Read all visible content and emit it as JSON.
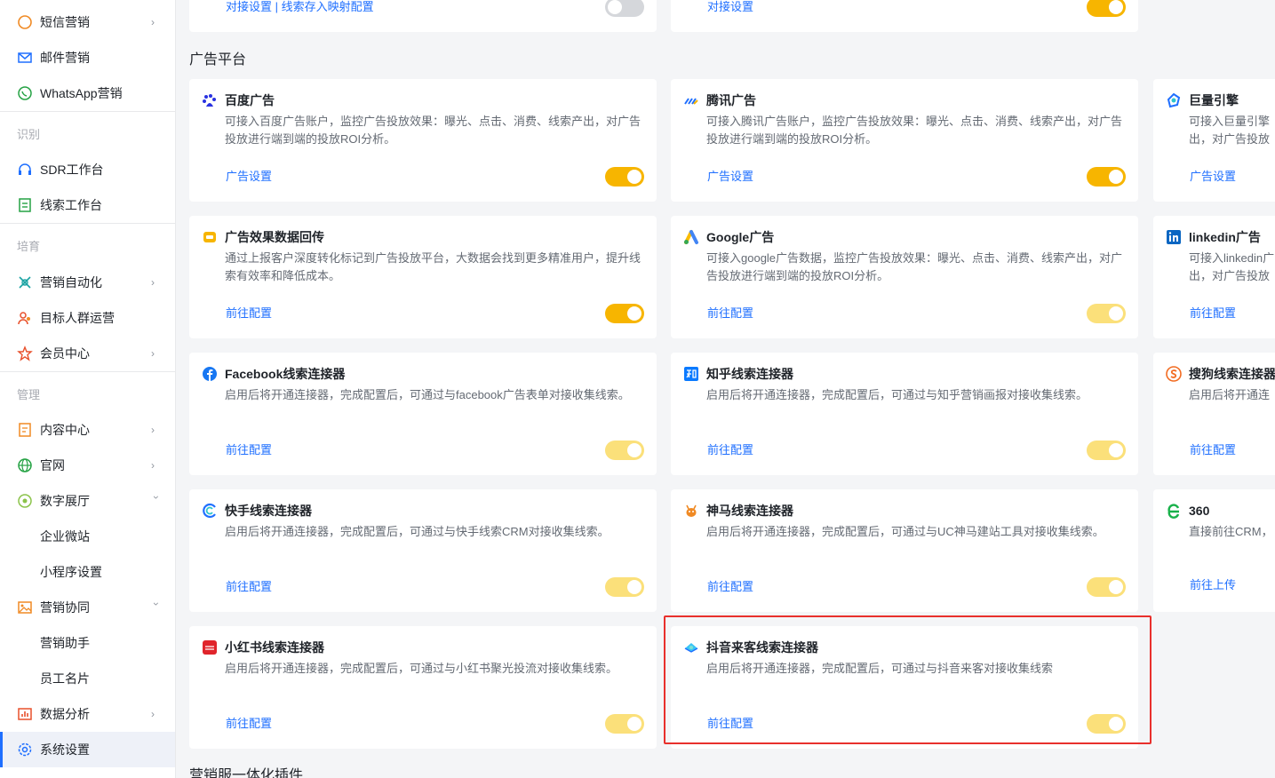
{
  "sidebar": {
    "items": [
      {
        "label": "短信营销",
        "icon": "sms-icon"
      },
      {
        "label": "邮件营销",
        "icon": "mail-icon"
      },
      {
        "label": "WhatsApp营销",
        "icon": "whatsapp-icon"
      },
      {
        "label": "SDR工作台",
        "icon": "headset-icon"
      },
      {
        "label": "线索工作台",
        "icon": "board-icon"
      },
      {
        "label": "营销自动化",
        "icon": "automation-icon"
      },
      {
        "label": "目标人群运营",
        "icon": "people-icon"
      },
      {
        "label": "会员中心",
        "icon": "star-icon"
      },
      {
        "label": "内容中心",
        "icon": "document-icon"
      },
      {
        "label": "官网",
        "icon": "globe-icon"
      },
      {
        "label": "数字展厅",
        "icon": "gallery-icon"
      },
      {
        "label": "企业微站"
      },
      {
        "label": "小程序设置"
      },
      {
        "label": "营销协同",
        "icon": "image-icon"
      },
      {
        "label": "营销助手"
      },
      {
        "label": "员工名片"
      },
      {
        "label": "数据分析",
        "icon": "chart-icon"
      },
      {
        "label": "系统设置",
        "icon": "gear-icon"
      }
    ],
    "sections": {
      "identify": "识别",
      "cultivate": "培育",
      "manage": "管理"
    }
  },
  "top_cards": {
    "left_link": "对接设置 | 线索存入映射配置",
    "right_link": "对接设置"
  },
  "ad_section": {
    "title": "广告平台",
    "cards": [
      {
        "title": "百度广告",
        "desc": "可接入百度广告账户，监控广告投放效果：曝光、点击、消费、线索产出，对广告投放进行端到端的投放ROI分析。",
        "link": "广告设置"
      },
      {
        "title": "腾讯广告",
        "desc": "可接入腾讯广告账户，监控广告投放效果：曝光、点击、消费、线索产出，对广告投放进行端到端的投放ROI分析。",
        "link": "广告设置"
      },
      {
        "title": "巨量引擎",
        "desc": "可接入巨量引擎出，对广告投放",
        "link": "广告设置"
      },
      {
        "title": "广告效果数据回传",
        "desc": "通过上报客户深度转化标记到广告投放平台，大数据会找到更多精准用户，提升线索有效率和降低成本。",
        "link": "前往配置"
      },
      {
        "title": "Google广告",
        "desc": "可接入google广告数据，监控广告投放效果：曝光、点击、消费、线索产出，对广告投放进行端到端的投放ROI分析。",
        "link": "前往配置"
      },
      {
        "title": "linkedin广告",
        "desc": "可接入linkedin广出，对广告投放",
        "link": "前往配置"
      },
      {
        "title": "Facebook线索连接器",
        "desc": "启用后将开通连接器，完成配置后，可通过与facebook广告表单对接收集线索。",
        "link": "前往配置"
      },
      {
        "title": "知乎线索连接器",
        "desc": "启用后将开通连接器，完成配置后，可通过与知乎营销画报对接收集线索。",
        "link": "前往配置"
      },
      {
        "title": "搜狗线索连接器",
        "desc": "启用后将开通连",
        "link": "前往配置"
      },
      {
        "title": "快手线索连接器",
        "desc": "启用后将开通连接器，完成配置后，可通过与快手线索CRM对接收集线索。",
        "link": "前往配置"
      },
      {
        "title": "神马线索连接器",
        "desc": "启用后将开通连接器，完成配置后，可通过与UC神马建站工具对接收集线索。",
        "link": "前往配置"
      },
      {
        "title": "360",
        "desc": "直接前往CRM，",
        "link": "前往上传"
      },
      {
        "title": "小红书线索连接器",
        "desc": "启用后将开通连接器，完成配置后，可通过与小红书聚光投流对接收集线索。",
        "link": "前往配置"
      },
      {
        "title": "抖音来客线索连接器",
        "desc": "启用后将开通连接器，完成配置后，可通过与抖音来客对接收集线索",
        "link": "前往配置"
      }
    ]
  },
  "next_section": {
    "title": "营销服一体化插件"
  },
  "colors": {
    "accent": "#1f6fff",
    "toggle_on": "#f7b500",
    "toggle_dim": "#fbe07a",
    "highlight": "#e8302c"
  }
}
